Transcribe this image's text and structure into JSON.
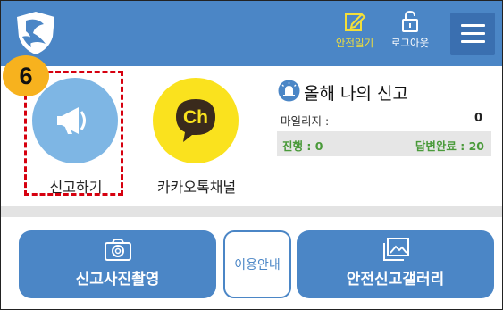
{
  "header": {
    "diary_label": "안전일기",
    "logout_label": "로그아웃"
  },
  "step_number": "6",
  "quick_actions": {
    "report_label": "신고하기",
    "kakao_label": "카카오톡채널",
    "kakao_icon_text": "Ch"
  },
  "stats": {
    "title": "올해 나의 신고",
    "mileage_label": "마일리지 :",
    "mileage_value": "0",
    "in_progress": "진행 : 0",
    "answered": "답변완료 : 20"
  },
  "bottom_buttons": {
    "photo_label": "신고사진촬영",
    "guide_label": "이용안내",
    "gallery_label": "안전신고갤러리"
  },
  "colors": {
    "header_bg": "#4b86c6",
    "accent_yellow": "#f3df3a",
    "highlight_red": "#d6000f",
    "badge_orange": "#f7b21e",
    "progress_green": "#4a9a3a"
  },
  "icons": {
    "logo": "shield-logo-icon",
    "diary": "edit-note-icon",
    "logout": "unlock-icon",
    "menu": "hamburger-menu-icon",
    "report": "megaphone-icon",
    "kakao": "kakao-channel-icon",
    "stats": "alarm-light-icon",
    "photo": "camera-icon",
    "gallery": "gallery-icon"
  }
}
